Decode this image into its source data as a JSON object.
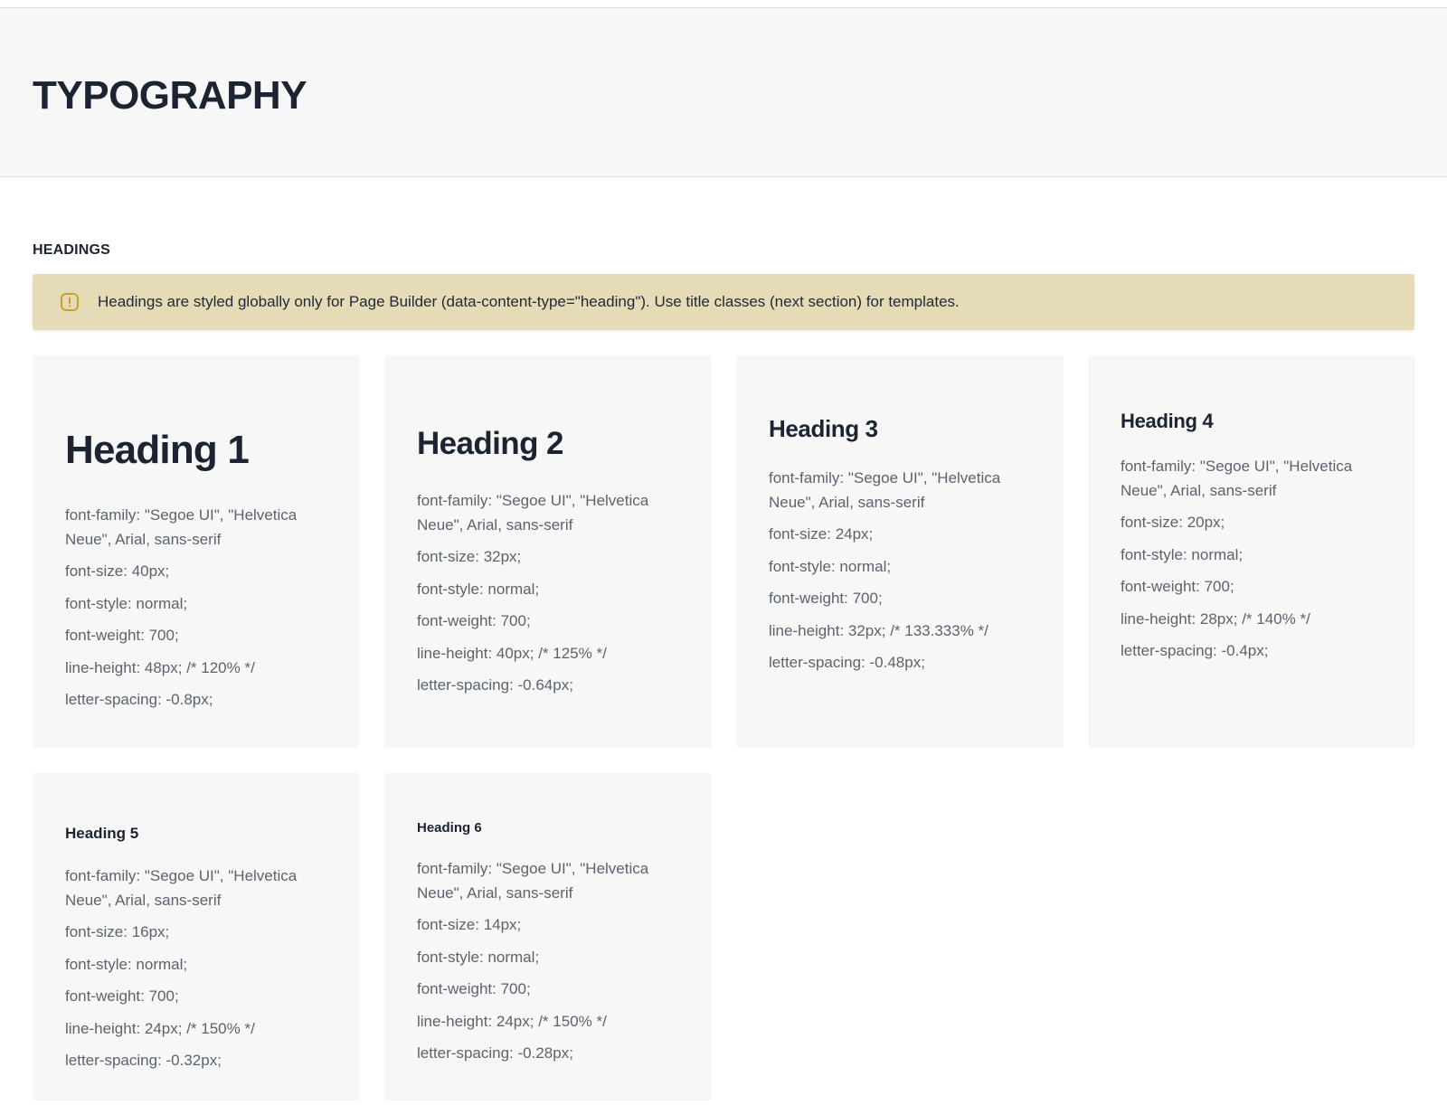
{
  "page": {
    "title": "TYPOGRAPHY"
  },
  "section": {
    "title": "HEADINGS"
  },
  "notice": {
    "icon": "alert-square-icon",
    "text": "Headings are styled globally only for Page Builder (data-content-type=\"heading\"). Use title classes (next section) for templates.",
    "background": "#e5dbb7",
    "icon_color": "#c9a227"
  },
  "cards": [
    {
      "heading": "Heading 1",
      "specs": [
        "font-family: \"Segoe UI\", \"Helvetica Neue\", Arial, sans-serif",
        "font-size: 40px;",
        "font-style: normal;",
        "font-weight: 700;",
        "line-height: 48px; /* 120% */",
        "letter-spacing: -0.8px;"
      ]
    },
    {
      "heading": "Heading 2",
      "specs": [
        "font-family: \"Segoe UI\", \"Helvetica Neue\", Arial, sans-serif",
        "font-size: 32px;",
        "font-style: normal;",
        "font-weight: 700;",
        "line-height: 40px; /* 125% */",
        "letter-spacing: -0.64px;"
      ]
    },
    {
      "heading": "Heading 3",
      "specs": [
        "font-family: \"Segoe UI\", \"Helvetica Neue\", Arial, sans-serif",
        "font-size: 24px;",
        "font-style: normal;",
        "font-weight: 700;",
        "line-height: 32px; /* 133.333% */",
        "letter-spacing: -0.48px;"
      ]
    },
    {
      "heading": "Heading 4",
      "specs": [
        "font-family: \"Segoe UI\", \"Helvetica Neue\", Arial, sans-serif",
        "font-size: 20px;",
        "font-style: normal;",
        "font-weight: 700;",
        "line-height: 28px; /* 140% */",
        "letter-spacing: -0.4px;"
      ]
    },
    {
      "heading": "Heading 5",
      "specs": [
        "font-family: \"Segoe UI\", \"Helvetica Neue\", Arial, sans-serif",
        "font-size: 16px;",
        "font-style: normal;",
        "font-weight: 700;",
        "line-height: 24px; /* 150% */",
        "letter-spacing: -0.32px;"
      ]
    },
    {
      "heading": "Heading 6",
      "specs": [
        "font-family: \"Segoe UI\", \"Helvetica Neue\", Arial, sans-serif",
        "font-size: 14px;",
        "font-style: normal;",
        "font-weight: 700;",
        "line-height: 24px; /* 150% */",
        "letter-spacing: -0.28px;"
      ]
    }
  ]
}
